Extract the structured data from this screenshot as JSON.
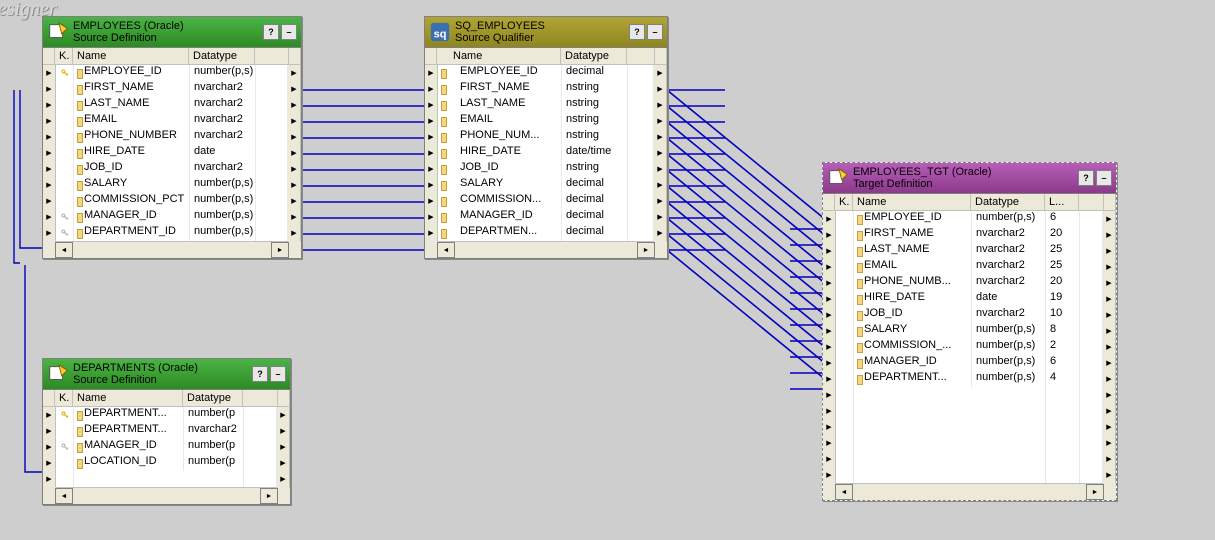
{
  "designer_label": "esigner",
  "panels": {
    "emp_src": {
      "title": "EMPLOYEES (Oracle)",
      "subtitle": "Source Definition",
      "headers": {
        "k": "K.",
        "name": "Name",
        "dtype": "Datatype"
      },
      "rows": [
        {
          "key": "pk",
          "name": "EMPLOYEE_ID",
          "dtype": "number(p,s)"
        },
        {
          "key": "",
          "name": "FIRST_NAME",
          "dtype": "nvarchar2"
        },
        {
          "key": "",
          "name": "LAST_NAME",
          "dtype": "nvarchar2"
        },
        {
          "key": "",
          "name": "EMAIL",
          "dtype": "nvarchar2"
        },
        {
          "key": "",
          "name": "PHONE_NUMBER",
          "dtype": "nvarchar2"
        },
        {
          "key": "",
          "name": "HIRE_DATE",
          "dtype": "date"
        },
        {
          "key": "",
          "name": "JOB_ID",
          "dtype": "nvarchar2"
        },
        {
          "key": "",
          "name": "SALARY",
          "dtype": "number(p,s)"
        },
        {
          "key": "",
          "name": "COMMISSION_PCT",
          "dtype": "number(p,s)"
        },
        {
          "key": "fk",
          "name": "MANAGER_ID",
          "dtype": "number(p,s)"
        },
        {
          "key": "fk",
          "name": "DEPARTMENT_ID",
          "dtype": "number(p,s)"
        }
      ]
    },
    "dept_src": {
      "title": "DEPARTMENTS (Oracle)",
      "subtitle": "Source Definition",
      "headers": {
        "k": "K.",
        "name": "Name",
        "dtype": "Datatype"
      },
      "rows": [
        {
          "key": "pk",
          "name": "DEPARTMENT...",
          "dtype": "number(p"
        },
        {
          "key": "",
          "name": "DEPARTMENT...",
          "dtype": "nvarchar2"
        },
        {
          "key": "fk",
          "name": "MANAGER_ID",
          "dtype": "number(p"
        },
        {
          "key": "",
          "name": "LOCATION_ID",
          "dtype": "number(p"
        }
      ]
    },
    "sq": {
      "title": "SQ_EMPLOYEES",
      "subtitle": "Source Qualifier",
      "headers": {
        "name": "Name",
        "dtype": "Datatype"
      },
      "rows": [
        {
          "name": "EMPLOYEE_ID",
          "dtype": "decimal"
        },
        {
          "name": "FIRST_NAME",
          "dtype": "nstring"
        },
        {
          "name": "LAST_NAME",
          "dtype": "nstring"
        },
        {
          "name": "EMAIL",
          "dtype": "nstring"
        },
        {
          "name": "PHONE_NUM...",
          "dtype": "nstring"
        },
        {
          "name": "HIRE_DATE",
          "dtype": "date/time"
        },
        {
          "name": "JOB_ID",
          "dtype": "nstring"
        },
        {
          "name": "SALARY",
          "dtype": "decimal"
        },
        {
          "name": "COMMISSION...",
          "dtype": "decimal"
        },
        {
          "name": "MANAGER_ID",
          "dtype": "decimal"
        },
        {
          "name": "DEPARTMEN...",
          "dtype": "decimal"
        }
      ]
    },
    "tgt": {
      "title": "EMPLOYEES_TGT (Oracle)",
      "subtitle": "Target Definition",
      "headers": {
        "k": "K.",
        "name": "Name",
        "dtype": "Datatype",
        "len": "L..."
      },
      "rows": [
        {
          "key": "",
          "name": "EMPLOYEE_ID",
          "dtype": "number(p,s)",
          "len": "6"
        },
        {
          "key": "",
          "name": "FIRST_NAME",
          "dtype": "nvarchar2",
          "len": "20"
        },
        {
          "key": "",
          "name": "LAST_NAME",
          "dtype": "nvarchar2",
          "len": "25"
        },
        {
          "key": "",
          "name": "EMAIL",
          "dtype": "nvarchar2",
          "len": "25"
        },
        {
          "key": "",
          "name": "PHONE_NUMB...",
          "dtype": "nvarchar2",
          "len": "20"
        },
        {
          "key": "",
          "name": "HIRE_DATE",
          "dtype": "date",
          "len": "19"
        },
        {
          "key": "",
          "name": "JOB_ID",
          "dtype": "nvarchar2",
          "len": "10"
        },
        {
          "key": "",
          "name": "SALARY",
          "dtype": "number(p,s)",
          "len": "8"
        },
        {
          "key": "",
          "name": "COMMISSION_...",
          "dtype": "number(p,s)",
          "len": "2"
        },
        {
          "key": "",
          "name": "MANAGER_ID",
          "dtype": "number(p,s)",
          "len": "6"
        },
        {
          "key": "",
          "name": "DEPARTMENT...",
          "dtype": "number(p,s)",
          "len": "4"
        }
      ]
    }
  }
}
